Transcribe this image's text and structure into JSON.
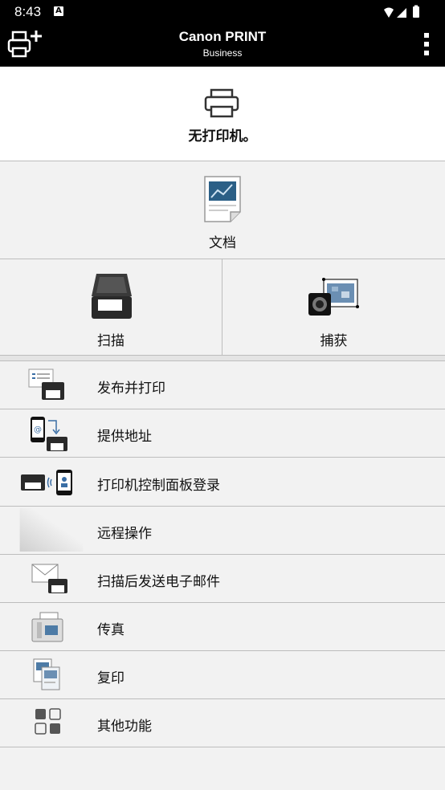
{
  "status": {
    "time": "8:43",
    "a_badge": "A"
  },
  "appbar": {
    "title": "Canon PRINT",
    "subtitle": "Business",
    "add_icon": "add-printer-icon",
    "menu_icon": "more-vert-icon"
  },
  "printer": {
    "label": "无打印机。",
    "icon": "printer-icon"
  },
  "tiles": {
    "document": {
      "label": "文档",
      "icon": "document-icon"
    },
    "scan": {
      "label": "扫描",
      "icon": "scanner-icon"
    },
    "capture": {
      "label": "捕获",
      "icon": "camera-capture-icon"
    }
  },
  "menu": [
    {
      "label": "发布并打印",
      "icon": "publish-print-icon"
    },
    {
      "label": "提供地址",
      "icon": "provide-address-icon"
    },
    {
      "label": "打印机控制面板登录",
      "icon": "panel-login-icon"
    },
    {
      "label": "远程操作",
      "icon": "remote-operation-icon"
    },
    {
      "label": "扫描后发送电子邮件",
      "icon": "scan-email-icon"
    },
    {
      "label": "传真",
      "icon": "fax-icon"
    },
    {
      "label": "复印",
      "icon": "copy-icon"
    },
    {
      "label": "其他功能",
      "icon": "other-functions-icon"
    }
  ]
}
